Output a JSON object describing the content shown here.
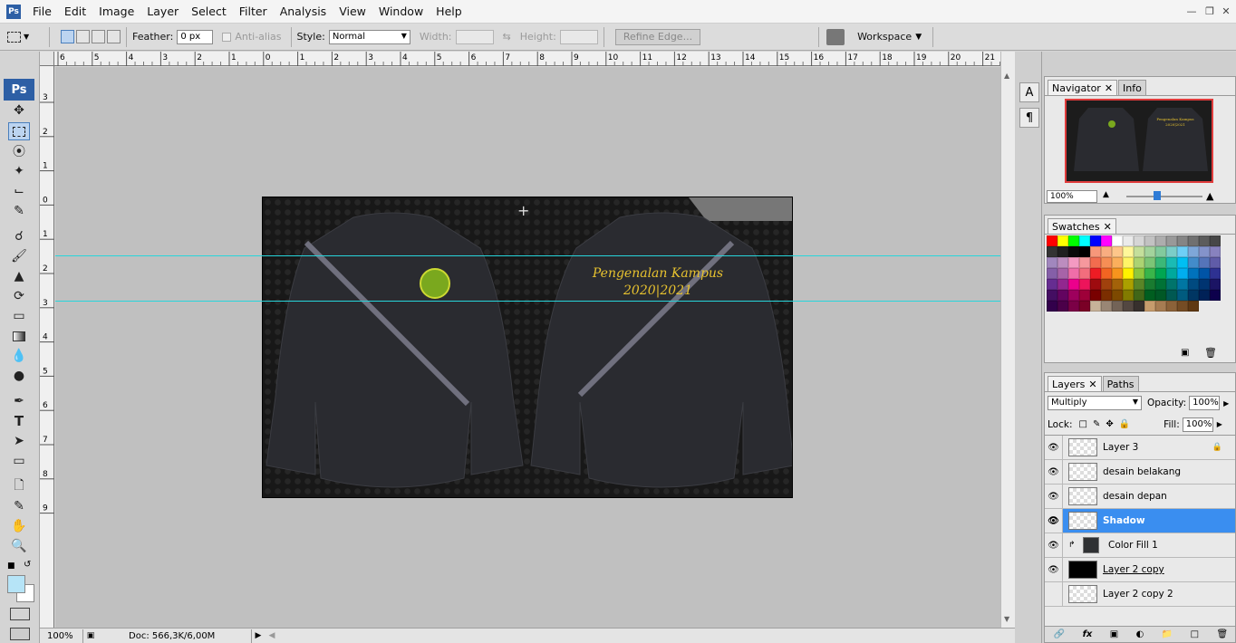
{
  "menubar": {
    "app_icon": "Ps",
    "items": [
      "File",
      "Edit",
      "Image",
      "Layer",
      "Select",
      "Filter",
      "Analysis",
      "View",
      "Window",
      "Help"
    ]
  },
  "options": {
    "feather_label": "Feather:",
    "feather_value": "0 px",
    "antialias_label": "Anti-alias",
    "style_label": "Style:",
    "style_value": "Normal",
    "width_label": "Width:",
    "height_label": "Height:",
    "refine_edge": "Refine Edge...",
    "workspace": "Workspace"
  },
  "tools": {
    "logo": "Ps"
  },
  "ruler": {
    "h_ticks": [
      "6",
      "5",
      "4",
      "3",
      "2",
      "1",
      "0",
      "1",
      "2",
      "3",
      "4",
      "5",
      "6",
      "7",
      "8",
      "9",
      "10",
      "11",
      "12",
      "13",
      "14",
      "15",
      "16",
      "17",
      "18",
      "19",
      "20",
      "21"
    ],
    "v_ticks": [
      "3",
      "2",
      "1",
      "0",
      "1",
      "2",
      "3",
      "4",
      "5",
      "6",
      "7",
      "8",
      "9"
    ]
  },
  "document": {
    "text_line1": "Pengenalan Kampus",
    "text_line2": "2020|2021"
  },
  "status": {
    "zoom": "100%",
    "doc": "Doc: 566,3K/6,00M"
  },
  "navigator": {
    "tabs": [
      "Navigator",
      "Info"
    ],
    "zoom": "100%",
    "thumb_text1": "Pengenalan Kampus",
    "thumb_text2": "2020|2021"
  },
  "swatches": {
    "tab": "Swatches",
    "colors": [
      "#ff0000",
      "#ffff00",
      "#00ff00",
      "#00ffff",
      "#0000ff",
      "#ff00ff",
      "#ffffff",
      "#ebebeb",
      "#d6d6d6",
      "#c2c2c2",
      "#adadad",
      "#999999",
      "#858585",
      "#707070",
      "#5c5c5c",
      "#474747",
      "#333333",
      "#1f1f1f",
      "#0a0a0a",
      "#000000",
      "#f7977a",
      "#f9ad81",
      "#fdc68a",
      "#fff79a",
      "#c4df9b",
      "#a3d39c",
      "#82ca9d",
      "#7bcdc8",
      "#6ecff6",
      "#7ea7d8",
      "#8493ca",
      "#8882be",
      "#a187be",
      "#bc8dbf",
      "#f49ac2",
      "#f6989d",
      "#f26c4f",
      "#f68e55",
      "#fbaf5c",
      "#fff467",
      "#acd372",
      "#7cc576",
      "#3bb878",
      "#1abbb4",
      "#00bff3",
      "#438cca",
      "#5574b9",
      "#605ca8",
      "#855fa8",
      "#a763a8",
      "#f06ea9",
      "#f26d7d",
      "#ed1c24",
      "#f26522",
      "#f7941d",
      "#fff200",
      "#8dc73f",
      "#39b54a",
      "#00a651",
      "#00a99d",
      "#00aeef",
      "#0072bc",
      "#0054a6",
      "#2e3192",
      "#662d91",
      "#92278f",
      "#ec008c",
      "#ed145b",
      "#9e0b0f",
      "#a0410d",
      "#a36209",
      "#aba000",
      "#598527",
      "#197b30",
      "#007236",
      "#00746b",
      "#0076a3",
      "#004a80",
      "#003471",
      "#1b1464",
      "#440e62",
      "#630460",
      "#9e005d",
      "#9e0039",
      "#790000",
      "#7b2e00",
      "#7d4900",
      "#827b00",
      "#406618",
      "#005e20",
      "#005826",
      "#005952",
      "#005b7f",
      "#003663",
      "#002157",
      "#0d004c",
      "#32004b",
      "#4b0049",
      "#7b0046",
      "#7a0026",
      "#c7b299",
      "#998675",
      "#736357",
      "#534741",
      "#37302d",
      "#c69c6d",
      "#a67c52",
      "#8c6239",
      "#754c24",
      "#603913"
    ]
  },
  "layers": {
    "tabs": [
      "Layers",
      "Paths"
    ],
    "blend_mode": "Multiply",
    "opacity_label": "Opacity:",
    "opacity_value": "100%",
    "lock_label": "Lock:",
    "fill_label": "Fill:",
    "fill_value": "100%",
    "rows": [
      {
        "name": "Layer 3"
      },
      {
        "name": "desain belakang"
      },
      {
        "name": "desain depan"
      },
      {
        "name": "Shadow"
      },
      {
        "name": "Color Fill 1"
      },
      {
        "name": "Layer 2 copy"
      },
      {
        "name": "Layer 2 copy 2"
      }
    ]
  }
}
